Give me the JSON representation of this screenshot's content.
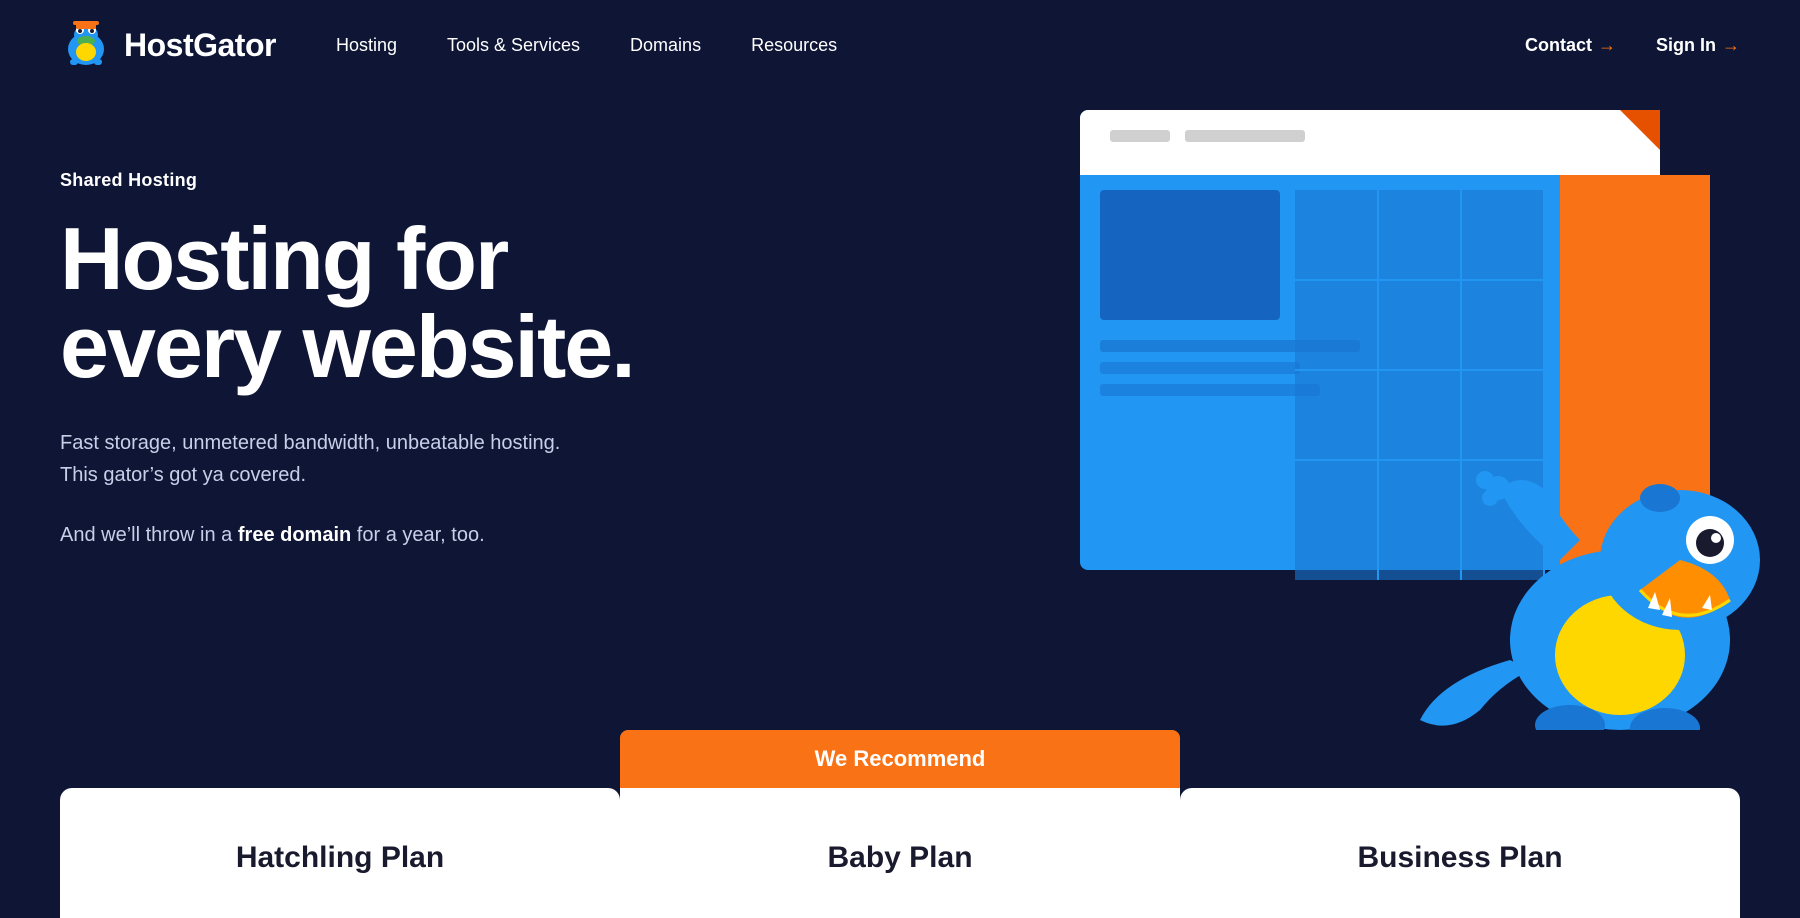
{
  "nav": {
    "logo_text": "HostGator",
    "links": [
      {
        "label": "Hosting",
        "id": "hosting"
      },
      {
        "label": "Tools & Services",
        "id": "tools-services"
      },
      {
        "label": "Domains",
        "id": "domains"
      },
      {
        "label": "Resources",
        "id": "resources"
      }
    ],
    "right_links": [
      {
        "label": "Contact",
        "id": "contact"
      },
      {
        "label": "Sign In",
        "id": "sign-in"
      }
    ]
  },
  "hero": {
    "subtitle": "Shared Hosting",
    "title": "Hosting for every website.",
    "description": "Fast storage, unmetered bandwidth, unbeatable hosting. This gator’s got ya covered.",
    "free_domain_text_before": "And we’ll throw in a ",
    "free_domain_bold": "free domain",
    "free_domain_text_after": " for a year, too."
  },
  "pricing": {
    "recommend_label": "We Recommend",
    "cards": [
      {
        "label": "Hatchling Plan",
        "id": "hatchling",
        "recommended": false
      },
      {
        "label": "Baby Plan",
        "id": "baby",
        "recommended": true
      },
      {
        "label": "Business Plan",
        "id": "business",
        "recommended": false
      }
    ]
  },
  "colors": {
    "bg": "#0f1535",
    "accent_orange": "#f97316",
    "white": "#ffffff",
    "card_bg": "#ffffff",
    "card_title": "#1a1a2e"
  }
}
